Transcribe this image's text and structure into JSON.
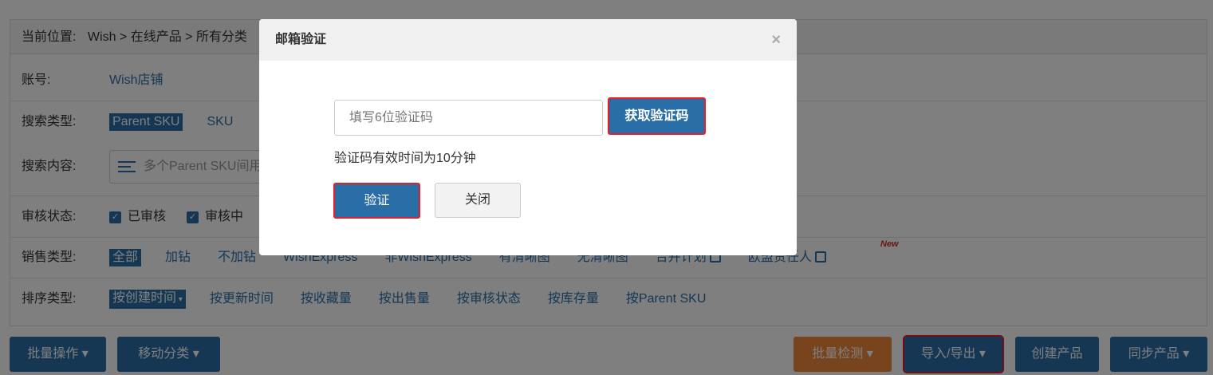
{
  "breadcrumb": {
    "label": "当前位置:",
    "path": "Wish > 在线产品 > 所有分类"
  },
  "account": {
    "label": "账号:",
    "value": "Wish店铺"
  },
  "search_type": {
    "label": "搜索类型:",
    "options": [
      "Parent SKU",
      "SKU"
    ]
  },
  "search_content": {
    "label": "搜索内容:",
    "placeholder": "多个Parent SKU间用"
  },
  "audit_status": {
    "label": "审核状态:",
    "options": [
      "已审核",
      "审核中"
    ]
  },
  "sale_type": {
    "label": "销售类型:",
    "options": [
      "全部",
      "加钻",
      "不加钻",
      "WishExpress",
      "非WishExpress",
      "有清晰图",
      "无清晰图",
      "合并计划",
      "欧盟责任人"
    ],
    "new_tag": "New"
  },
  "sort_type": {
    "label": "排序类型:",
    "options": [
      "按创建时间",
      "按更新时间",
      "按收藏量",
      "按出售量",
      "按审核状态",
      "按库存量",
      "按Parent SKU"
    ]
  },
  "toolbar": {
    "batch_ops": "批量操作 ▾",
    "move_category": "移动分类 ▾",
    "batch_check": "批量检测 ▾",
    "import_export": "导入/导出 ▾",
    "create_product": "创建产品",
    "sync_product": "同步产品 ▾"
  },
  "modal": {
    "title": "邮箱验证",
    "close_symbol": "×",
    "code_placeholder": "填写6位验证码",
    "get_code_label": "获取验证码",
    "hint": "验证码有效时间为10分钟",
    "verify_label": "验证",
    "close_label": "关闭"
  }
}
